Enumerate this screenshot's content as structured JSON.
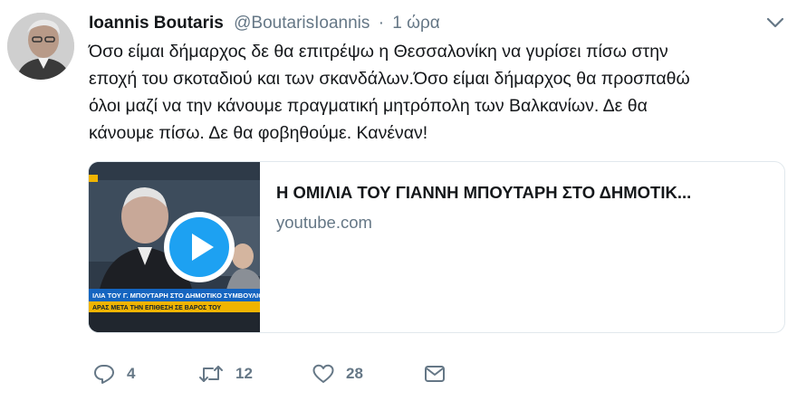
{
  "author": {
    "name": "Ioannis Boutaris",
    "handle": "@BoutarisIoannis",
    "separator": "·",
    "time": "1 ώρα"
  },
  "tweet": {
    "lines": [
      "Όσο είμαι δήμαρχος δε θα επιτρέψω η Θεσσαλονίκη να γυρίσει πίσω στην",
      "εποχή του σκοταδιού και των σκανδάλων.Όσο είμαι δήμαρχος θα προσπαθώ",
      "όλοι μαζί να την κάνουμε πραγματική μητρόπολη των Βαλκανίων. Δε θα",
      "κάνουμε πίσω. Δε θα φοβηθούμε. Κανέναν!"
    ]
  },
  "card": {
    "title": "Η ΟΜΙΛΙΑ ΤΟΥ ΓΙΑΝΝΗ ΜΠΟΥΤΑΡΗ ΣΤΟ ΔΗΜΟΤΙΚ...",
    "domain": "youtube.com",
    "thumbnail_caption_1": "ΙΛΙΑ ΤΟΥ Γ. ΜΠΟΥΤΑΡΗ ΣΤΟ ΔΗΜΟΤΙΚΟ ΣΥΜΒΟΥΛΙΟ",
    "thumbnail_caption_2": "ΑΡΑΣ ΜΕΤΑ ΤΗΝ ΕΠΙΘΕΣΗ ΣΕ ΒΑΡΟΣ ΤΟΥ"
  },
  "actions": {
    "replies": "4",
    "retweets": "12",
    "likes": "28"
  },
  "colors": {
    "text": "#14171a",
    "secondary": "#657786",
    "border": "#e1e8ed",
    "play": "#1da1f2"
  },
  "icons": [
    "chevron-down-icon",
    "play-icon",
    "reply-icon",
    "retweet-icon",
    "like-icon",
    "message-icon"
  ]
}
